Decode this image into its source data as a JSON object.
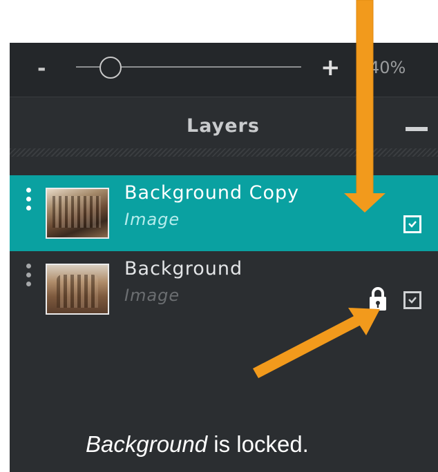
{
  "zoom": {
    "minus_label": "-",
    "plus_label": "+",
    "value": "40%",
    "slider_level_percent": 12
  },
  "layers_panel": {
    "title": "Layers",
    "collapse_label": "−",
    "layers": [
      {
        "name": "Background Copy",
        "type": "Image",
        "selected": true,
        "locked": false,
        "visible": true,
        "thumbnail_icon": "photo-thumbnail-icon"
      },
      {
        "name": "Background",
        "type": "Image",
        "selected": false,
        "locked": true,
        "visible": true,
        "thumbnail_icon": "photo-thumbnail-icon"
      }
    ]
  },
  "annotation": {
    "caption_emphasis": "Background",
    "caption_rest": " is locked.",
    "arrow_color": "#f29a1c"
  },
  "colors": {
    "selected_row": "#0aa1a1",
    "panel_bg": "#2b2e31"
  }
}
